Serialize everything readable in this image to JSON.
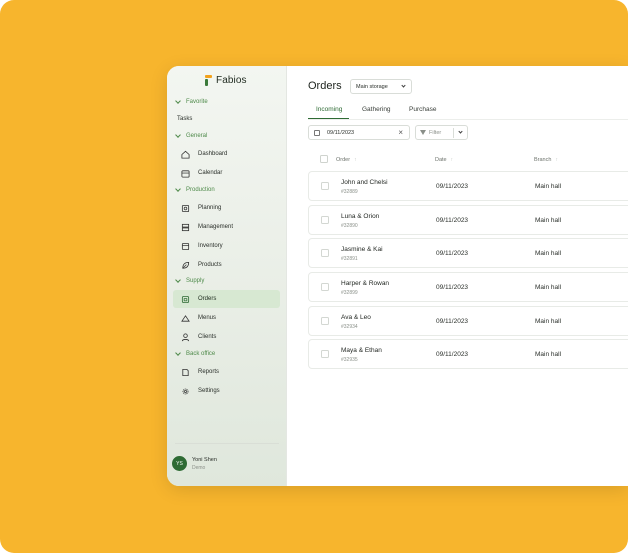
{
  "app": {
    "logo": "Fabios"
  },
  "sidebar": {
    "favorites_label": "Favorite",
    "tasks_label": "Tasks",
    "groups": [
      {
        "label": "General",
        "items": [
          {
            "label": "Dashboard",
            "icon": "home-icon"
          },
          {
            "label": "Calendar",
            "icon": "calendar-icon"
          }
        ]
      },
      {
        "label": "Production",
        "items": [
          {
            "label": "Planning",
            "icon": "planning-icon"
          },
          {
            "label": "Management",
            "icon": "management-icon"
          },
          {
            "label": "Inventory",
            "icon": "inventory-icon"
          },
          {
            "label": "Products",
            "icon": "leaf-icon"
          }
        ]
      },
      {
        "label": "Supply",
        "items": [
          {
            "label": "Orders",
            "icon": "orders-icon"
          },
          {
            "label": "Menus",
            "icon": "menus-icon"
          },
          {
            "label": "Clients",
            "icon": "person-icon"
          }
        ]
      },
      {
        "label": "Back office",
        "items": [
          {
            "label": "Reports",
            "icon": "document-icon"
          },
          {
            "label": "Settings",
            "icon": "gear-icon"
          }
        ]
      }
    ],
    "active_item": "Orders",
    "user": {
      "initials": "YS",
      "name": "Yoni Shen",
      "role": "Demo"
    }
  },
  "main": {
    "title": "Orders",
    "storage_select": "Main storage",
    "tabs": [
      "Incoming",
      "Gathering",
      "Purchase"
    ],
    "active_tab": "Incoming",
    "date_filter": "09/11/2023",
    "filter_placeholder": "Filter",
    "columns": [
      "Order",
      "Date",
      "Branch"
    ],
    "rows": [
      {
        "name": "John and Chelsi",
        "id": "#32889",
        "date": "09/11/2023",
        "branch": "Main hall"
      },
      {
        "name": "Luna & Orion",
        "id": "#32890",
        "date": "09/11/2023",
        "branch": "Main hall"
      },
      {
        "name": "Jasmine & Kai",
        "id": "#32891",
        "date": "09/11/2023",
        "branch": "Main hall"
      },
      {
        "name": "Harper & Rowan",
        "id": "#32899",
        "date": "09/11/2023",
        "branch": "Main hall"
      },
      {
        "name": "Ava & Leo",
        "id": "#32934",
        "date": "09/11/2023",
        "branch": "Main hall"
      },
      {
        "name": "Maya & Ethan",
        "id": "#32935",
        "date": "09/11/2023",
        "branch": "Main hall"
      }
    ]
  },
  "colors": {
    "background": "#f7b52d",
    "accent": "#2e6b34",
    "active_item_bg": "#d7e8d2"
  }
}
